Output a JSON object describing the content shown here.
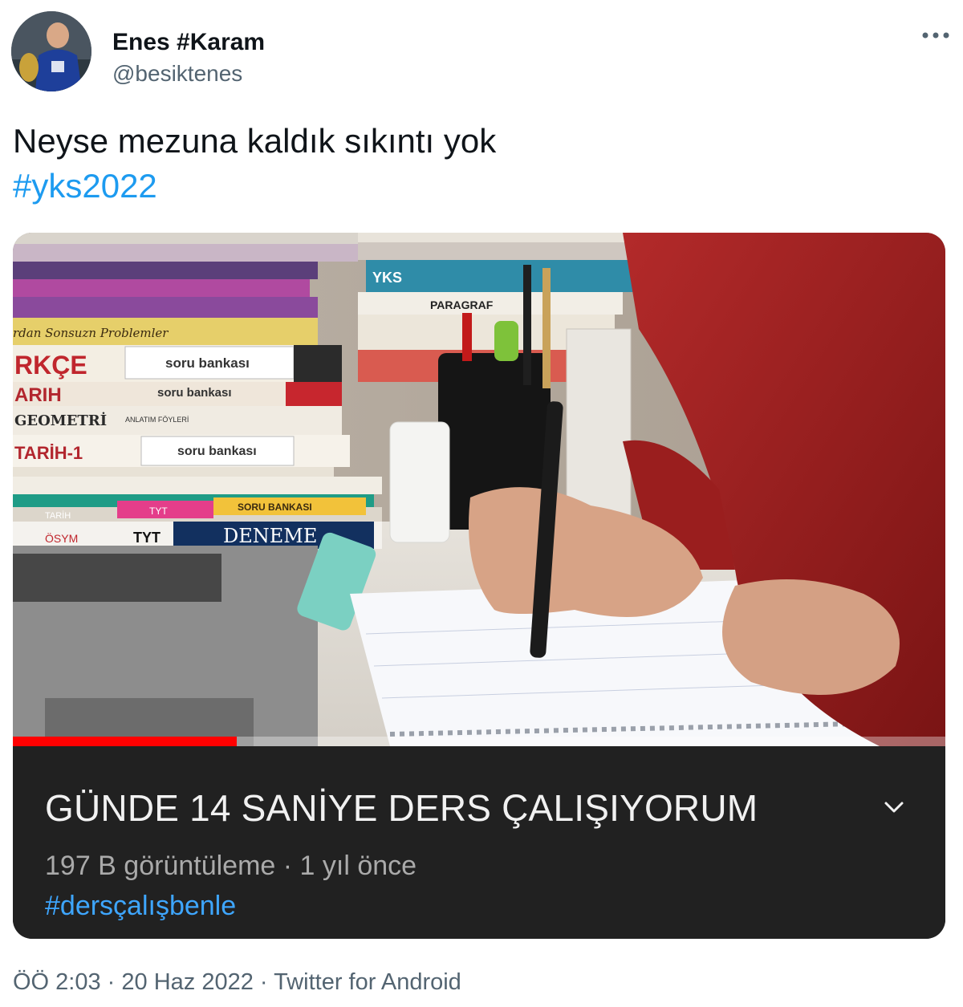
{
  "tweet": {
    "author_name": "Enes #Karam",
    "author_handle": "@besiktenes",
    "text": "Neyse mezuna kaldık sıkıntı yok",
    "hashtag": "#yks2022",
    "footer": "ÖÖ 2:03 · 20 Haz 2022 · Twitter for Android",
    "more_icon": "more-horizontal-icon"
  },
  "video_card": {
    "title": "GÜNDE 14 SANİYE DERS ÇALIŞIYORUM",
    "meta": "197 B görüntüleme · 1 yıl önce",
    "hashtag": "#dersçalışbenle",
    "progress_fraction": 0.24,
    "expand_icon": "chevron-down-icon",
    "book_labels": {
      "rkce": "RKÇE",
      "soru_bankasi_1": "soru bankası",
      "arih": "ARIH",
      "soru_bankasi_2": "soru bankası",
      "geometri": "GEOMETRİ",
      "anlatim": "ANLATIM FÖYLERİ",
      "tarih1": "TARİH-1",
      "soru_bankasi_3": "soru bankası",
      "soru_bankasi_caps": "SORU BANKASI",
      "tyt_1": "TYT",
      "tyt_2": "TYT",
      "deneme": "DENEME",
      "yks": "YKS",
      "paragraf": "PARAGRAF",
      "sonsuzn": "rdan Sonsuzn Problemler",
      "tarih_small": "TARİH",
      "osym": "ÖSYM"
    }
  },
  "colors": {
    "link_blue": "#1d9bf0",
    "yt_link_blue": "#3ea6ff",
    "progress_red": "#ff0000",
    "card_bg": "#212121"
  }
}
